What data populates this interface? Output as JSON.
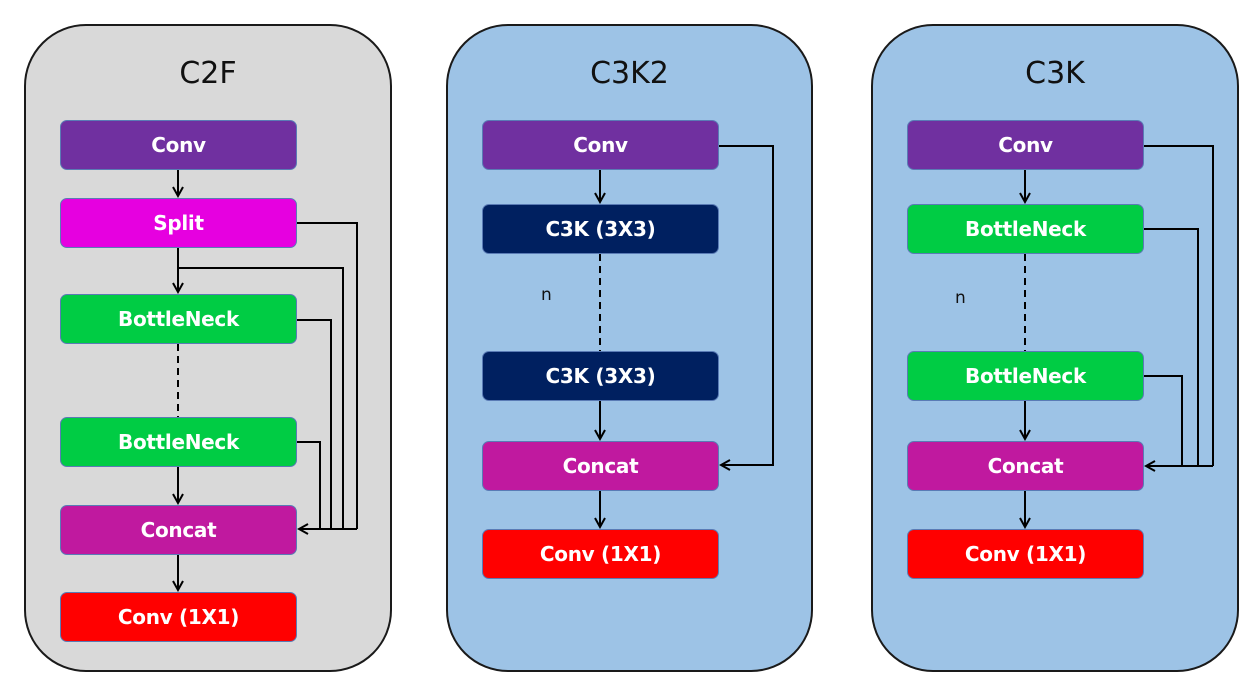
{
  "colors": {
    "conv": "#7030a0",
    "split": "#e600e0",
    "bottleneck": "#00cc44",
    "c3k_block": "#002060",
    "concat": "#c0199f",
    "conv1x1": "#ff0000",
    "panel_gray": "#d9d9d9",
    "panel_blue": "#9dc3e6",
    "line": "#000000"
  },
  "panels": [
    {
      "id": "c2f",
      "title": "C2F",
      "blocks": [
        {
          "label": "Conv",
          "type": "conv"
        },
        {
          "label": "Split",
          "type": "split"
        },
        {
          "label": "BottleNeck",
          "type": "bottleneck"
        },
        {
          "label": "BottleNeck",
          "type": "bottleneck"
        },
        {
          "label": "Concat",
          "type": "concat"
        },
        {
          "label": "Conv (1X1)",
          "type": "conv1x1"
        }
      ],
      "repeat_label": ""
    },
    {
      "id": "c3k2",
      "title": "C3K2",
      "blocks": [
        {
          "label": "Conv",
          "type": "conv"
        },
        {
          "label": "C3K (3X3)",
          "type": "c3k_block"
        },
        {
          "label": "C3K (3X3)",
          "type": "c3k_block"
        },
        {
          "label": "Concat",
          "type": "concat"
        },
        {
          "label": "Conv (1X1)",
          "type": "conv1x1"
        }
      ],
      "repeat_label": "n"
    },
    {
      "id": "c3k",
      "title": "C3K",
      "blocks": [
        {
          "label": "Conv",
          "type": "conv"
        },
        {
          "label": "BottleNeck",
          "type": "bottleneck"
        },
        {
          "label": "BottleNeck",
          "type": "bottleneck"
        },
        {
          "label": "Concat",
          "type": "concat"
        },
        {
          "label": "Conv (1X1)",
          "type": "conv1x1"
        }
      ],
      "repeat_label": "n"
    }
  ]
}
